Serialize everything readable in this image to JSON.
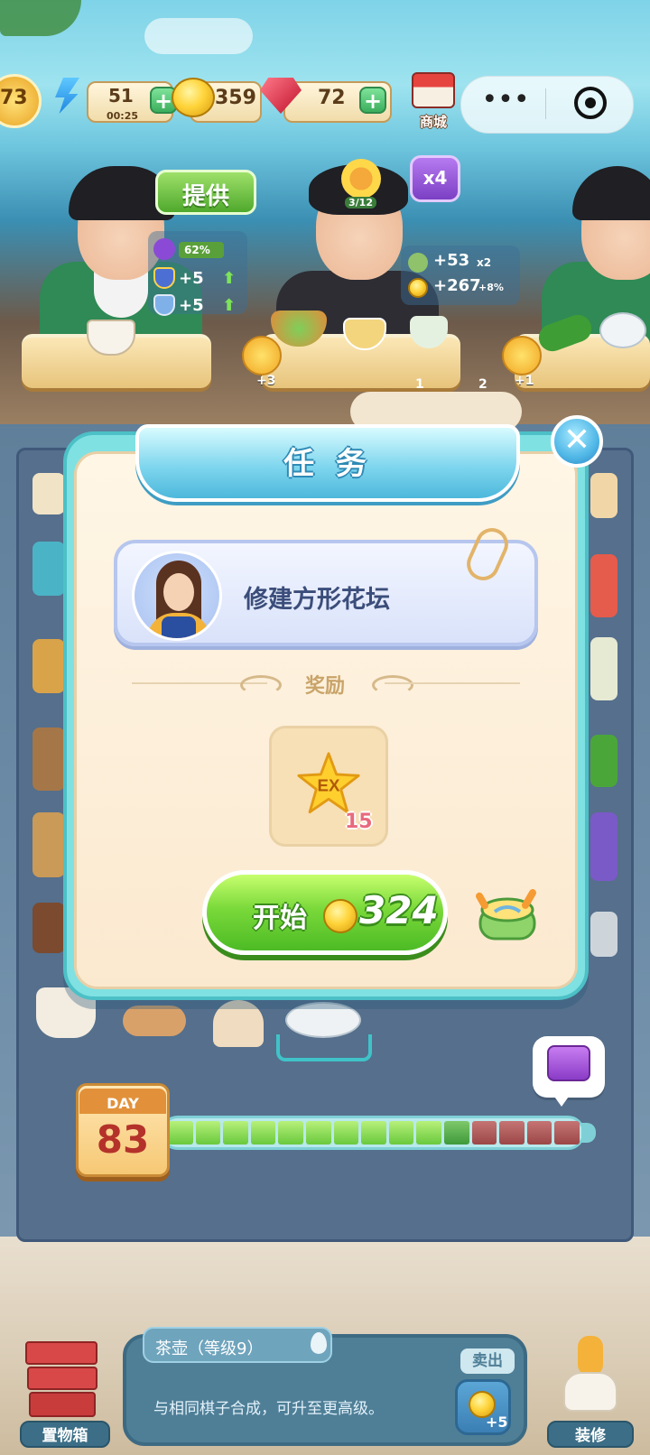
{
  "hud": {
    "level": "73",
    "energy": "51",
    "energy_timer": "00:25",
    "coins": "359",
    "gems": "72",
    "shop_label": "商城"
  },
  "scene": {
    "serve_button": "提供",
    "stats": {
      "percent": "62%",
      "stat_a": "+5",
      "stat_b": "+5"
    },
    "customer_progress": "3/12",
    "multiplier": "x4",
    "bonus_a": "+53",
    "bonus_a_mult": "x2",
    "bonus_b": "+267",
    "bonus_b_pct": "+8%",
    "smiley_left_bonus": "+3",
    "smiley_right_bonus": "+1",
    "ticket_a": "1",
    "ticket_b": "2"
  },
  "modal": {
    "title": "任 务",
    "close_symbol": "✕",
    "task_text": "修建方形花坛",
    "reward_label": "奖励",
    "reward_icon_text": "EX",
    "reward_amount": "15",
    "start_label": "开始",
    "start_cost": "324"
  },
  "day": {
    "label": "DAY",
    "number": "83",
    "progress_done": 10,
    "progress_current": 1,
    "progress_total": 15
  },
  "bottom": {
    "storage_label": "置物箱",
    "item_title": "茶壶（等级9）",
    "item_desc": "与相同棋子合成，可升至更高级。",
    "sell_label": "卖出",
    "sell_amount": "+5",
    "decorate_label": "装修"
  },
  "icons": {
    "coin": "coin-icon",
    "gem": "ruby-icon",
    "energy": "lightning-icon",
    "chest": "chest-icon",
    "pot": "pot-icon",
    "star": "ex-star-icon"
  },
  "colors": {
    "modal_border": "#7fe1e2",
    "start_button": "#4dbb25",
    "title_bar": "#4db8dc"
  }
}
